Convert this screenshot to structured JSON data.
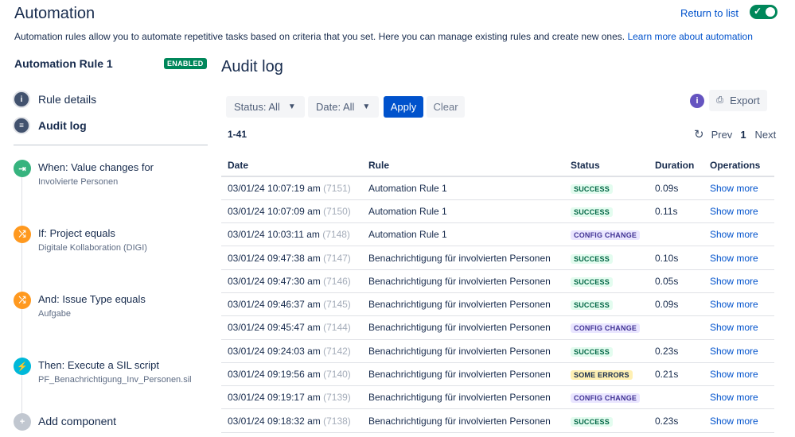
{
  "header": {
    "title": "Automation",
    "return_link": "Return to list",
    "description": "Automation rules allow you to automate repetitive tasks based on criteria that you set. Here you can manage existing rules and create new ones. ",
    "learn_more": "Learn more about automation",
    "toggle_on": true
  },
  "sidebar": {
    "rule_name": "Automation Rule 1",
    "status_badge": "ENABLED",
    "nav": [
      {
        "label": "Rule details",
        "icon": "info-icon"
      },
      {
        "label": "Audit log",
        "icon": "list-icon",
        "active": true
      }
    ],
    "components": [
      {
        "title": "When: Value changes for",
        "sub": "Involvierte Personen",
        "icon": "trigger-icon",
        "color": "#36b37e"
      },
      {
        "title": "If: Project equals",
        "sub": "Digitale Kollaboration (DIGI)",
        "icon": "condition-icon",
        "color": "#ff991f"
      },
      {
        "title": "And: Issue Type equals",
        "sub": "Aufgabe",
        "icon": "condition-icon",
        "color": "#ff991f"
      },
      {
        "title": "Then: Execute a SIL script",
        "sub": "PF_Benachrichtigung_Inv_Personen.sil",
        "icon": "action-icon",
        "color": "#00b8d9"
      }
    ],
    "add_component": "Add component"
  },
  "main": {
    "title": "Audit log",
    "filters": {
      "status": "Status: All",
      "date": "Date: All",
      "apply": "Apply",
      "clear": "Clear"
    },
    "export": "Export",
    "range": "1-41",
    "pager": {
      "prev": "Prev",
      "current": "1",
      "next": "Next"
    },
    "columns": [
      "Date",
      "Rule",
      "Status",
      "Duration",
      "Operations"
    ],
    "rows": [
      {
        "date": "03/01/24 10:07:19 am",
        "id": "(7151)",
        "rule": "Automation Rule 1",
        "status": "SUCCESS",
        "kind": "success",
        "duration": "0.09s",
        "op": "Show more"
      },
      {
        "date": "03/01/24 10:07:09 am",
        "id": "(7150)",
        "rule": "Automation Rule 1",
        "status": "SUCCESS",
        "kind": "success",
        "duration": "0.11s",
        "op": "Show more"
      },
      {
        "date": "03/01/24 10:03:11 am",
        "id": "(7148)",
        "rule": "Automation Rule 1",
        "status": "CONFIG CHANGE",
        "kind": "config",
        "duration": "",
        "op": "Show more"
      },
      {
        "date": "03/01/24 09:47:38 am",
        "id": "(7147)",
        "rule": "Benachrichtigung für involvierten Personen",
        "status": "SUCCESS",
        "kind": "success",
        "duration": "0.10s",
        "op": "Show more"
      },
      {
        "date": "03/01/24 09:47:30 am",
        "id": "(7146)",
        "rule": "Benachrichtigung für involvierten Personen",
        "status": "SUCCESS",
        "kind": "success",
        "duration": "0.05s",
        "op": "Show more"
      },
      {
        "date": "03/01/24 09:46:37 am",
        "id": "(7145)",
        "rule": "Benachrichtigung für involvierten Personen",
        "status": "SUCCESS",
        "kind": "success",
        "duration": "0.09s",
        "op": "Show more"
      },
      {
        "date": "03/01/24 09:45:47 am",
        "id": "(7144)",
        "rule": "Benachrichtigung für involvierten Personen",
        "status": "CONFIG CHANGE",
        "kind": "config",
        "duration": "",
        "op": "Show more"
      },
      {
        "date": "03/01/24 09:24:03 am",
        "id": "(7142)",
        "rule": "Benachrichtigung für involvierten Personen",
        "status": "SUCCESS",
        "kind": "success",
        "duration": "0.23s",
        "op": "Show more"
      },
      {
        "date": "03/01/24 09:19:56 am",
        "id": "(7140)",
        "rule": "Benachrichtigung für involvierten Personen",
        "status": "SOME ERRORS",
        "kind": "errors",
        "duration": "0.21s",
        "op": "Show more"
      },
      {
        "date": "03/01/24 09:19:17 am",
        "id": "(7139)",
        "rule": "Benachrichtigung für involvierten Personen",
        "status": "CONFIG CHANGE",
        "kind": "config",
        "duration": "",
        "op": "Show more"
      },
      {
        "date": "03/01/24 09:18:32 am",
        "id": "(7138)",
        "rule": "Benachrichtigung für involvierten Personen",
        "status": "SUCCESS",
        "kind": "success",
        "duration": "0.23s",
        "op": "Show more"
      }
    ]
  }
}
